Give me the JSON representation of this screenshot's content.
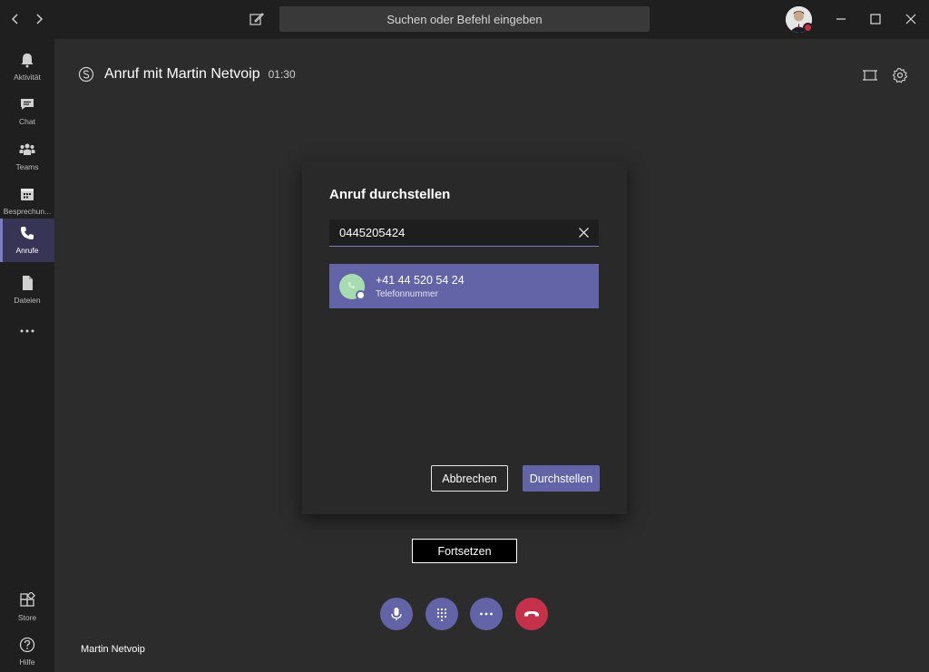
{
  "app": {
    "search_placeholder": "Suchen oder Befehl eingeben"
  },
  "rail": {
    "items": [
      {
        "label": "Aktivität",
        "icon": "bell-icon"
      },
      {
        "label": "Chat",
        "icon": "chat-icon"
      },
      {
        "label": "Teams",
        "icon": "teams-icon"
      },
      {
        "label": "Besprechun...",
        "icon": "calendar-icon"
      },
      {
        "label": "Anrufe",
        "icon": "phone-icon",
        "active": true
      },
      {
        "label": "Dateien",
        "icon": "file-icon"
      },
      {
        "label": "",
        "icon": "more-icon"
      }
    ],
    "bottom": [
      {
        "label": "Store",
        "icon": "store-icon"
      },
      {
        "label": "Hilfe",
        "icon": "help-icon"
      }
    ]
  },
  "call": {
    "title": "Anruf mit Martin Netvoip",
    "timer": "01:30",
    "participant": "Martin Netvoip"
  },
  "dialog": {
    "title": "Anruf durchstellen",
    "input_value": "0445205424",
    "suggestion": {
      "number": "+41 44 520 54 24",
      "type": "Telefonnummer"
    },
    "cancel_label": "Abbrechen",
    "transfer_label": "Durchstellen"
  },
  "resume_label": "Fortsetzen",
  "colors": {
    "accent": "#6264a7",
    "hangup": "#c4314b",
    "background": "#2d2c2c",
    "chrome": "#201f1f"
  }
}
